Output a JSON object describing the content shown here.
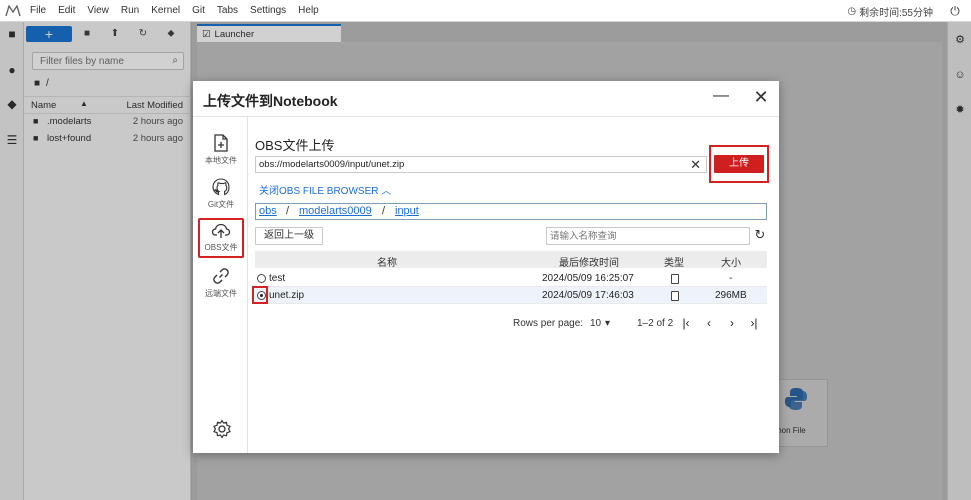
{
  "menubar": {
    "items": [
      "File",
      "Edit",
      "View",
      "Run",
      "Kernel",
      "Git",
      "Tabs",
      "Settings",
      "Help"
    ],
    "timer": "剩余时间:55分钟"
  },
  "filebrowser": {
    "filter_placeholder": "Filter files by name",
    "path": "/",
    "col_name": "Name",
    "col_modified": "Last Modified",
    "files": [
      {
        "name": ".modelarts",
        "modified": "2 hours ago"
      },
      {
        "name": "lost+found",
        "modified": "2 hours ago"
      }
    ]
  },
  "main": {
    "tab_label": "Launcher",
    "python_card_label": "thon File"
  },
  "dialog": {
    "title": "上传文件到Notebook",
    "sidebar": [
      {
        "label": "本地文件",
        "icon": "file-plus-icon"
      },
      {
        "label": "Git文件",
        "icon": "github-icon"
      },
      {
        "label": "OBS文件",
        "icon": "cloud-upload-icon"
      },
      {
        "label": "远端文件",
        "icon": "link-icon"
      }
    ],
    "section_title": "OBS文件上传",
    "path_value": "obs://modelarts0009/input/unet.zip",
    "upload_label": "上传",
    "toggle_label": "关闭OBS FILE BROWSER",
    "breadcrumb": [
      "obs",
      "modelarts0009",
      "input"
    ],
    "back_label": "返回上一级",
    "search_placeholder": "请输入名称查询",
    "table": {
      "columns": [
        "名称",
        "最后修改时间",
        "类型",
        "大小"
      ],
      "rows": [
        {
          "name": "test",
          "modified": "2024/05/09 16:25:07",
          "size": "-",
          "selected": false
        },
        {
          "name": "unet.zip",
          "modified": "2024/05/09 17:46:03",
          "size": "296MB",
          "selected": true
        }
      ]
    },
    "pager": {
      "rows_label": "Rows per page:",
      "rows_value": "10",
      "range": "1–2 of 2"
    }
  },
  "colors": {
    "accent_red": "#cf1f1f",
    "link_blue": "#1a6fd6",
    "new_button_blue": "#1976d2"
  }
}
